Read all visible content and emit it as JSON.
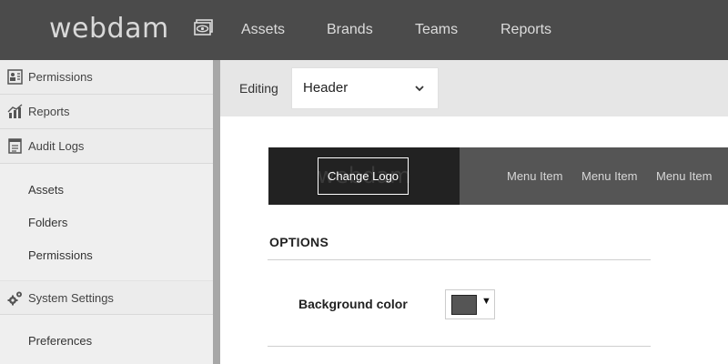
{
  "app": {
    "logo": "webdam"
  },
  "topnav": {
    "icon": "eye-icon",
    "items": [
      {
        "label": "Assets"
      },
      {
        "label": "Brands"
      },
      {
        "label": "Teams"
      },
      {
        "label": "Reports"
      }
    ]
  },
  "sidebar": {
    "sections": [
      {
        "label": "Permissions",
        "icon": "permissions-icon"
      },
      {
        "label": "Reports",
        "icon": "chart-icon"
      },
      {
        "label": "Audit Logs",
        "icon": "audit-log-icon"
      }
    ],
    "audit_subitems": [
      {
        "label": "Assets"
      },
      {
        "label": "Folders"
      },
      {
        "label": "Permissions"
      }
    ],
    "system_settings": {
      "label": "System Settings",
      "icon": "gears-icon"
    },
    "settings_subitems": [
      {
        "label": "Preferences"
      }
    ]
  },
  "editor": {
    "label": "Editing",
    "selected": "Header"
  },
  "preview": {
    "ghost_logo": "webdam",
    "change_logo_label": "Change Logo",
    "menu_items": [
      {
        "label": "Menu Item"
      },
      {
        "label": "Menu Item"
      },
      {
        "label": "Menu Item"
      }
    ]
  },
  "options": {
    "title": "OPTIONS",
    "background_color_label": "Background color",
    "background_color_value": "#555555",
    "arrow": "▼"
  },
  "colors": {
    "topbar": "#4b4b4b",
    "sidebar": "#efefef",
    "preview_bar": "#555555",
    "preview_logo_area": "#222222"
  }
}
